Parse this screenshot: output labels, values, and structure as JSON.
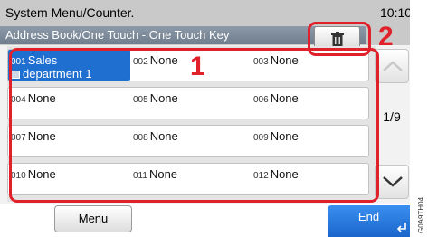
{
  "header": {
    "app_title": "System Menu/Counter.",
    "clock": "10:10",
    "subtitle": "Address Book/One Touch - One Touch Key"
  },
  "toolbar": {
    "delete_icon": "trash-icon"
  },
  "callouts": [
    "1",
    "2"
  ],
  "keys": [
    [
      {
        "num": "001",
        "name": "Sales",
        "name2": "department 1",
        "selected": true,
        "icon": "address-book-icon"
      },
      {
        "num": "002",
        "name": "None"
      },
      {
        "num": "003",
        "name": "None"
      }
    ],
    [
      {
        "num": "004",
        "name": "None"
      },
      {
        "num": "005",
        "name": "None"
      },
      {
        "num": "006",
        "name": "None"
      }
    ],
    [
      {
        "num": "007",
        "name": "None"
      },
      {
        "num": "008",
        "name": "None"
      },
      {
        "num": "009",
        "name": "None"
      }
    ],
    [
      {
        "num": "010",
        "name": "None"
      },
      {
        "num": "011",
        "name": "None"
      },
      {
        "num": "012",
        "name": "None"
      }
    ]
  ],
  "pagination": {
    "indicator": "1/9",
    "up_icon": "chevron-up-icon",
    "down_icon": "chevron-down-icon"
  },
  "footer": {
    "menu_label": "Menu",
    "end_label": "End",
    "enter_icon": "enter-arrow-icon"
  },
  "side_code": "G0A9TH04",
  "colors": {
    "accent": "#1f6fd1",
    "callout": "#e0212b",
    "header_gray": "#c9c9c9"
  }
}
